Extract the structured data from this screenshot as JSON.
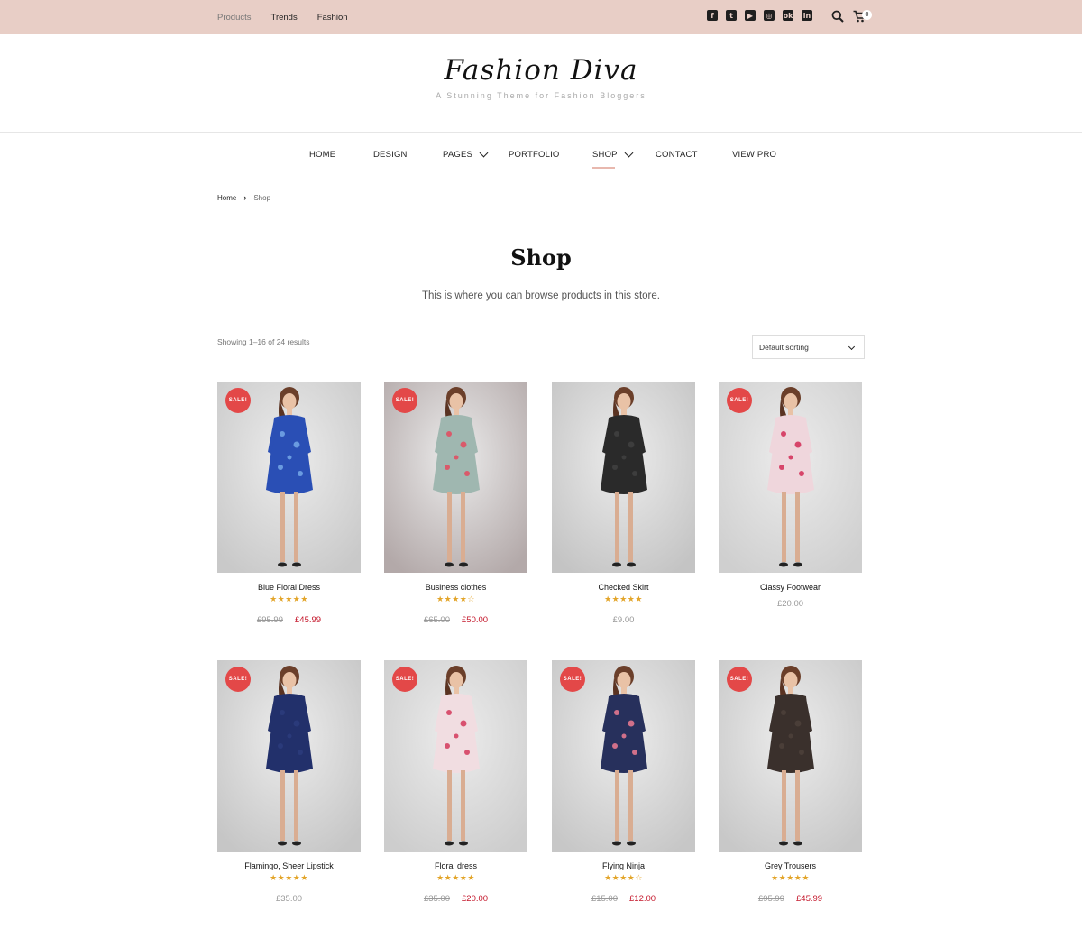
{
  "topbar": {
    "nav": [
      "Products",
      "Trends",
      "Fashion"
    ],
    "social_icons": [
      "facebook-icon",
      "twitter-icon",
      "youtube-icon",
      "instagram-icon",
      "odnoklassniki-icon",
      "linkedin-icon"
    ],
    "cart_count": "0",
    "background": "#e8cec6"
  },
  "header": {
    "title": "Fashion Diva",
    "tagline": "A Stunning Theme for Fashion Bloggers"
  },
  "mainnav": {
    "home": "HOME",
    "design": "DESIGN",
    "pages": "PAGES",
    "portfolio": "PORTFOLIO",
    "shop": "SHOP",
    "contact": "CONTACT",
    "viewpro": "VIEW PRO",
    "active": "SHOP"
  },
  "breadcrumb": {
    "home": "Home",
    "separator": "›",
    "current": "Shop"
  },
  "page": {
    "title": "Shop",
    "description": "This is where you can browse products in this store.",
    "result_count": "Showing 1–16 of 24 results",
    "sort_selected": "Default sorting"
  },
  "products": [
    {
      "name": "Blue Floral Dress",
      "sale": "SALE!",
      "stars": "★★★★★",
      "old_price": "£95.99",
      "price": "£45.99",
      "dress": "#2a4fb5",
      "pattern": "#6a9be0",
      "bg": "#c9c9c9"
    },
    {
      "name": "Business clothes",
      "sale": "SALE!",
      "stars": "★★★★☆",
      "old_price": "£65.00",
      "price": "£50.00",
      "dress": "#9fb7b0",
      "pattern": "#d95a6a",
      "bg": "#b3a9a9"
    },
    {
      "name": "Checked Skirt",
      "sale": "",
      "stars": "★★★★★",
      "old_price": "",
      "price": "£9.00",
      "dress": "#2a2a2a",
      "pattern": "#3d3d3d",
      "bg": "#c4c4c4"
    },
    {
      "name": "Classy Footwear",
      "sale": "SALE!",
      "stars": "",
      "old_price": "",
      "price": "£20.00",
      "dress": "#efd6dc",
      "pattern": "#d7456a",
      "bg": "#cfcfcf"
    },
    {
      "name": "Flamingo, Sheer Lipstick",
      "sale": "SALE!",
      "stars": "★★★★★",
      "old_price": "",
      "price": "£35.00",
      "dress": "#22306b",
      "pattern": "#2a3a7a",
      "bg": "#c6c6c6"
    },
    {
      "name": "Floral dress",
      "sale": "SALE!",
      "stars": "★★★★★",
      "old_price": "£35.00",
      "price": "£20.00",
      "dress": "#f1dde1",
      "pattern": "#d8516f",
      "bg": "#cdcdcd"
    },
    {
      "name": "Flying Ninja",
      "sale": "SALE!",
      "stars": "★★★★☆",
      "old_price": "£15.00",
      "price": "£12.00",
      "dress": "#27305c",
      "pattern": "#d0708a",
      "bg": "#c7c7c7"
    },
    {
      "name": "Grey Trousers",
      "sale": "SALE!",
      "stars": "★★★★★",
      "old_price": "£95.99",
      "price": "£45.99",
      "dress": "#3a302c",
      "pattern": "#4a3e38",
      "bg": "#c8c8c8"
    }
  ]
}
